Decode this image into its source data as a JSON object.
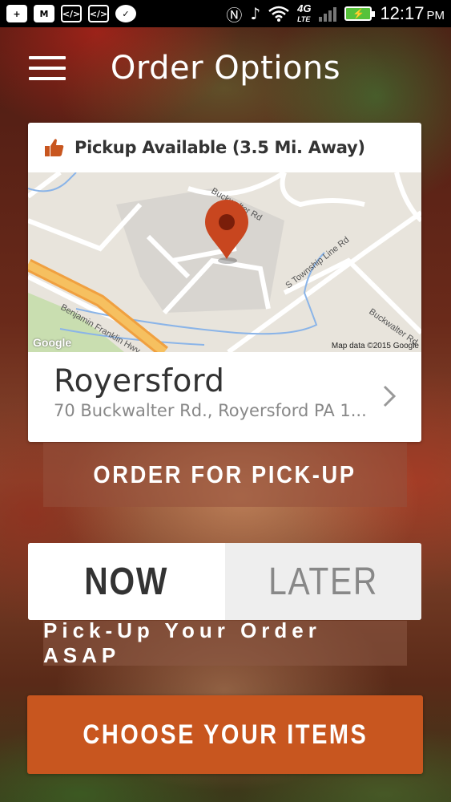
{
  "status_bar": {
    "time": "12:17",
    "ampm": "PM",
    "network": "4G",
    "network_sub": "LTE",
    "icons": [
      "plus-icon",
      "gmail-icon",
      "code-icon",
      "code-icon",
      "check-icon",
      "nfc-icon",
      "mute-icon",
      "wifi-icon",
      "signal-icon",
      "battery-icon"
    ]
  },
  "header": {
    "title": "Order Options"
  },
  "location_card": {
    "pickup_text": "Pickup Available (3.5 Mi. Away)",
    "map_credit": "Map data ©2015 Google",
    "google_logo": "Google",
    "map_labels": {
      "road1": "Benjamin Franklin Hwy",
      "road2": "S Township Line Rd",
      "road3": "Buckwalter Rd",
      "road4": "Buckwalter Rd"
    },
    "name": "Royersford",
    "address": "70 Buckwalter Rd., Royersford PA 1..."
  },
  "order_type": {
    "label": "ORDER FOR PICK-UP"
  },
  "timing": {
    "now_label": "NOW",
    "later_label": "LATER",
    "selected": "NOW",
    "description": "Pick-Up Your Order ASAP"
  },
  "actions": {
    "choose_items": "CHOOSE YOUR ITEMS"
  },
  "colors": {
    "accent": "#c8561f",
    "pin": "#c8461f",
    "battery": "#56c23a"
  }
}
